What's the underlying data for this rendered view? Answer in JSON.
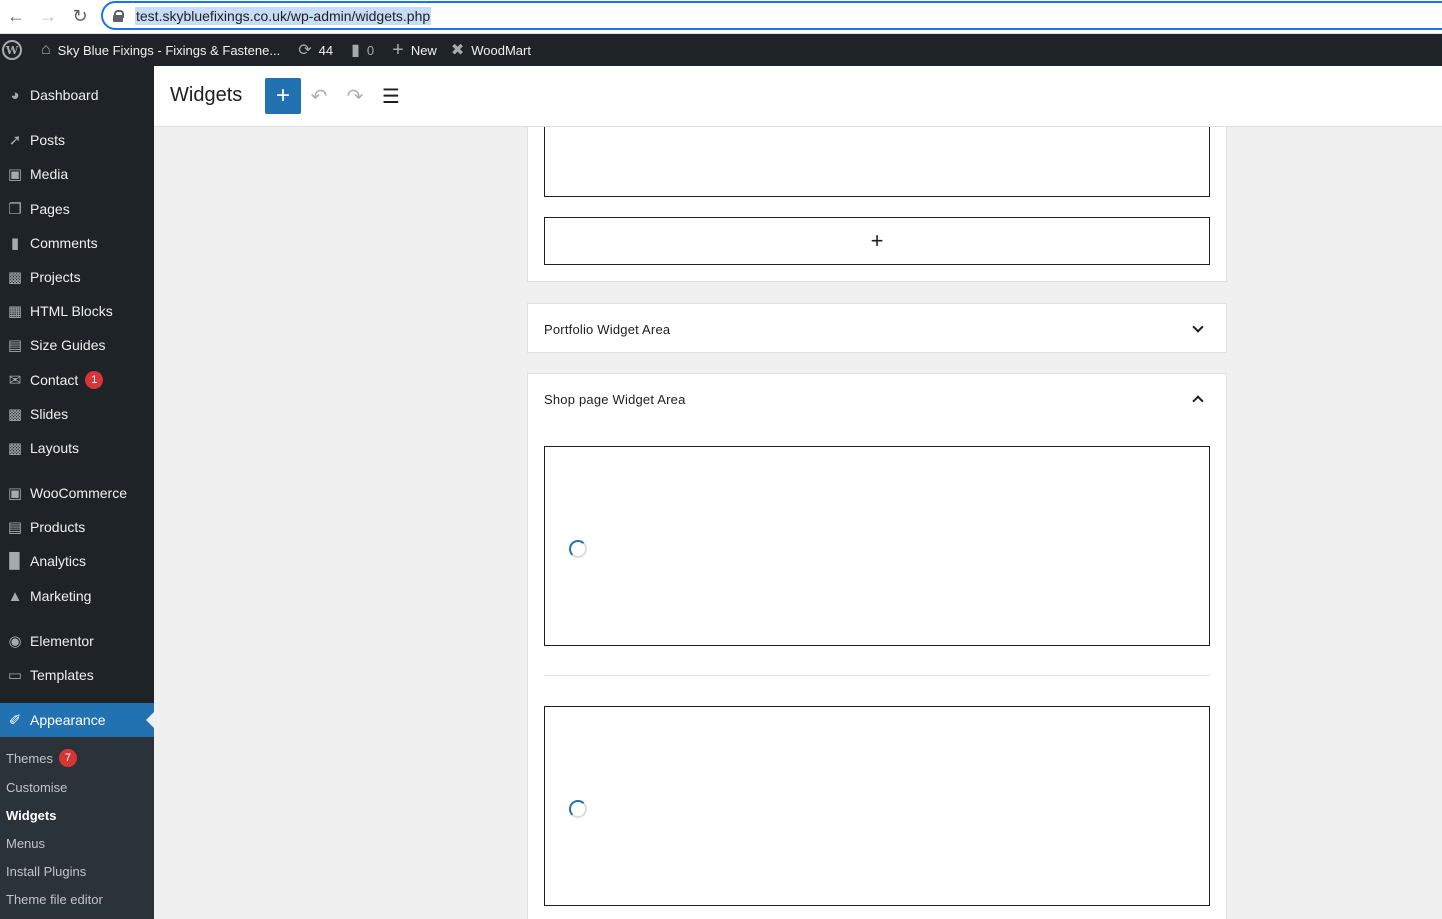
{
  "browser": {
    "url": "test.skybluefixings.co.uk/wp-admin/widgets.php"
  },
  "admin_bar": {
    "site_name": "Sky Blue Fixings - Fixings & Fastene...",
    "updates_count": "44",
    "comments_count": "0",
    "new_label": "New",
    "theme_label": "WoodMart"
  },
  "sidebar": {
    "items": [
      {
        "label": "Dashboard",
        "icon": "dashboard-icon"
      },
      {
        "label": "Posts",
        "icon": "pin-icon"
      },
      {
        "label": "Media",
        "icon": "media-icon"
      },
      {
        "label": "Pages",
        "icon": "pages-icon"
      },
      {
        "label": "Comments",
        "icon": "comment-icon"
      },
      {
        "label": "Projects",
        "icon": "portfolio-icon"
      },
      {
        "label": "HTML Blocks",
        "icon": "grid-icon"
      },
      {
        "label": "Size Guides",
        "icon": "table-icon"
      },
      {
        "label": "Contact",
        "icon": "mail-icon",
        "badge": "1"
      },
      {
        "label": "Slides",
        "icon": "slides-icon"
      },
      {
        "label": "Layouts",
        "icon": "layouts-icon"
      },
      {
        "label": "WooCommerce",
        "icon": "woo-icon"
      },
      {
        "label": "Products",
        "icon": "archive-icon"
      },
      {
        "label": "Analytics",
        "icon": "bar-chart-icon"
      },
      {
        "label": "Marketing",
        "icon": "megaphone-icon"
      },
      {
        "label": "Elementor",
        "icon": "elementor-icon"
      },
      {
        "label": "Templates",
        "icon": "folder-icon"
      },
      {
        "label": "Appearance",
        "icon": "brush-icon"
      }
    ],
    "submenu": [
      {
        "label": "Themes",
        "badge": "7"
      },
      {
        "label": "Customise"
      },
      {
        "label": "Widgets"
      },
      {
        "label": "Menus"
      },
      {
        "label": "Install Plugins"
      },
      {
        "label": "Theme file editor"
      }
    ]
  },
  "editor": {
    "title": "Widgets",
    "add_block_symbol": "+",
    "areas": [
      {
        "title": "Portfolio Widget Area",
        "expanded": false
      },
      {
        "title": "Shop page Widget Area",
        "expanded": true
      }
    ]
  }
}
